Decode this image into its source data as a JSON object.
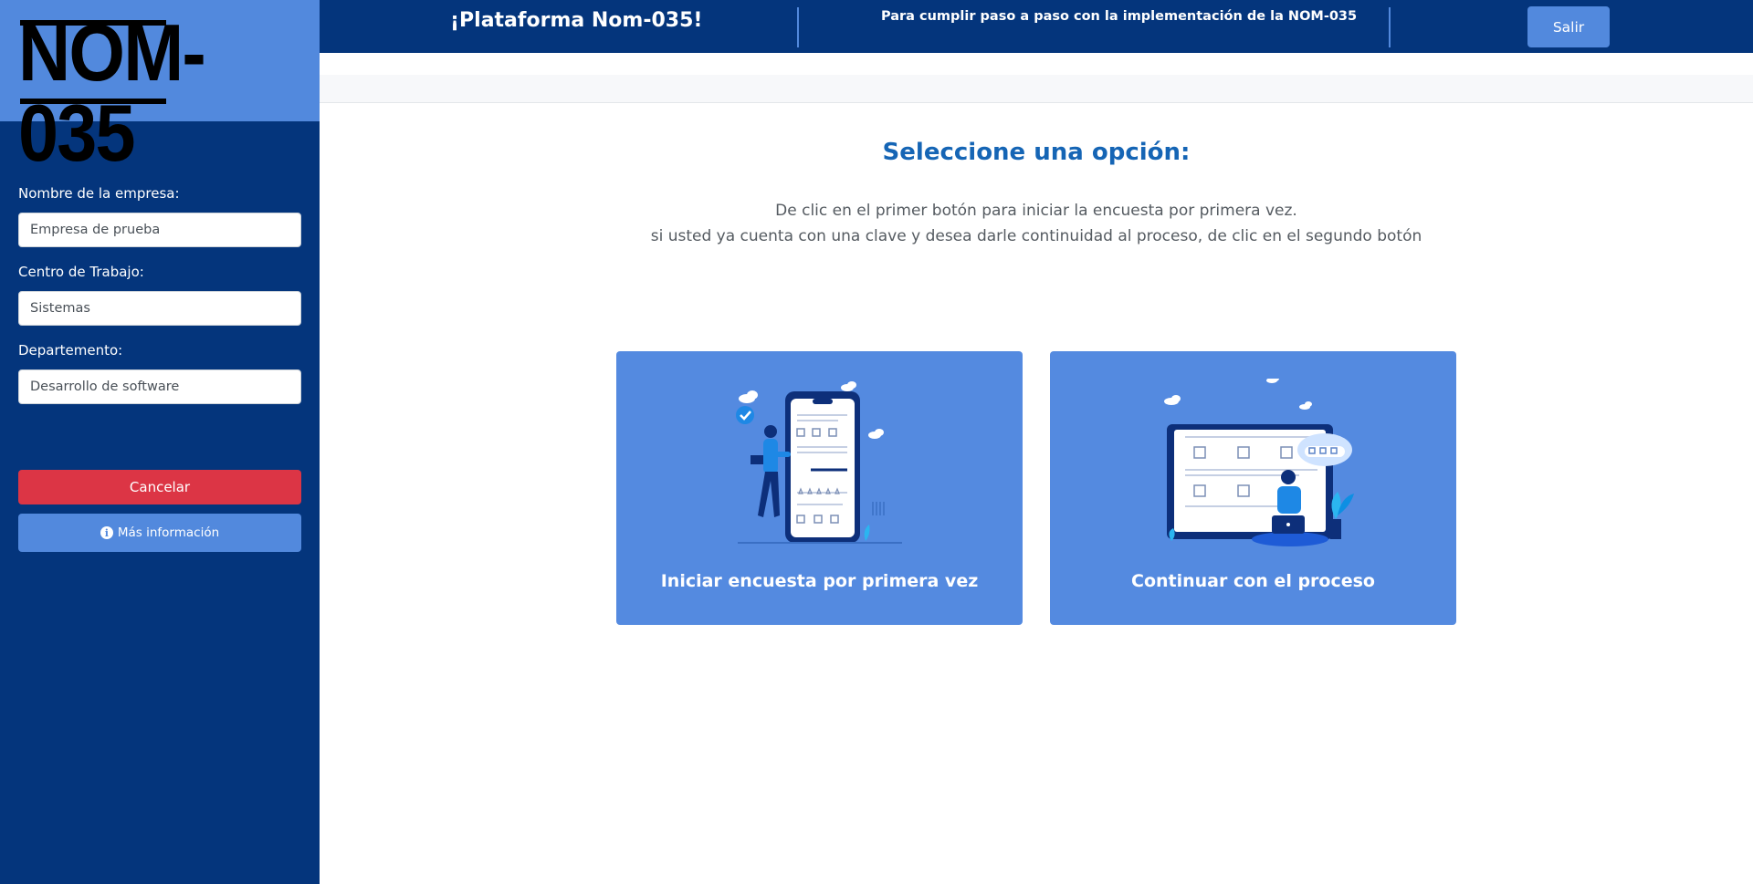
{
  "logo": {
    "text": "NOM-035"
  },
  "header": {
    "title": "¡Plataforma Nom-035!",
    "subtitle": "Para cumplir paso a paso con la implementación de la NOM-035",
    "logout_label": "Salir"
  },
  "sidebar": {
    "company_label": "Nombre de la empresa:",
    "company_value": "Empresa de prueba",
    "center_label": "Centro de Trabajo:",
    "center_value": "Sistemas",
    "department_label": "Departemento:",
    "department_value": "Desarrollo de software",
    "cancel_label": "Cancelar",
    "info_label": "Más información"
  },
  "main": {
    "title": "Seleccione una opción:",
    "description_line1": "De clic en el primer botón para iniciar la encuesta por primera vez.",
    "description_line2": "si usted ya cuenta con una clave y desea darle continuidad al proceso, de clic en el segundo botón",
    "cards": [
      {
        "label": "Iniciar encuesta por primera vez",
        "icon": "survey-phone-illustration"
      },
      {
        "label": "Continuar con el proceso",
        "icon": "laptop-process-illustration"
      }
    ]
  },
  "colors": {
    "sidebar": "#04357c",
    "accent": "#5289dd",
    "danger": "#dc3545",
    "title": "#1565b5"
  }
}
